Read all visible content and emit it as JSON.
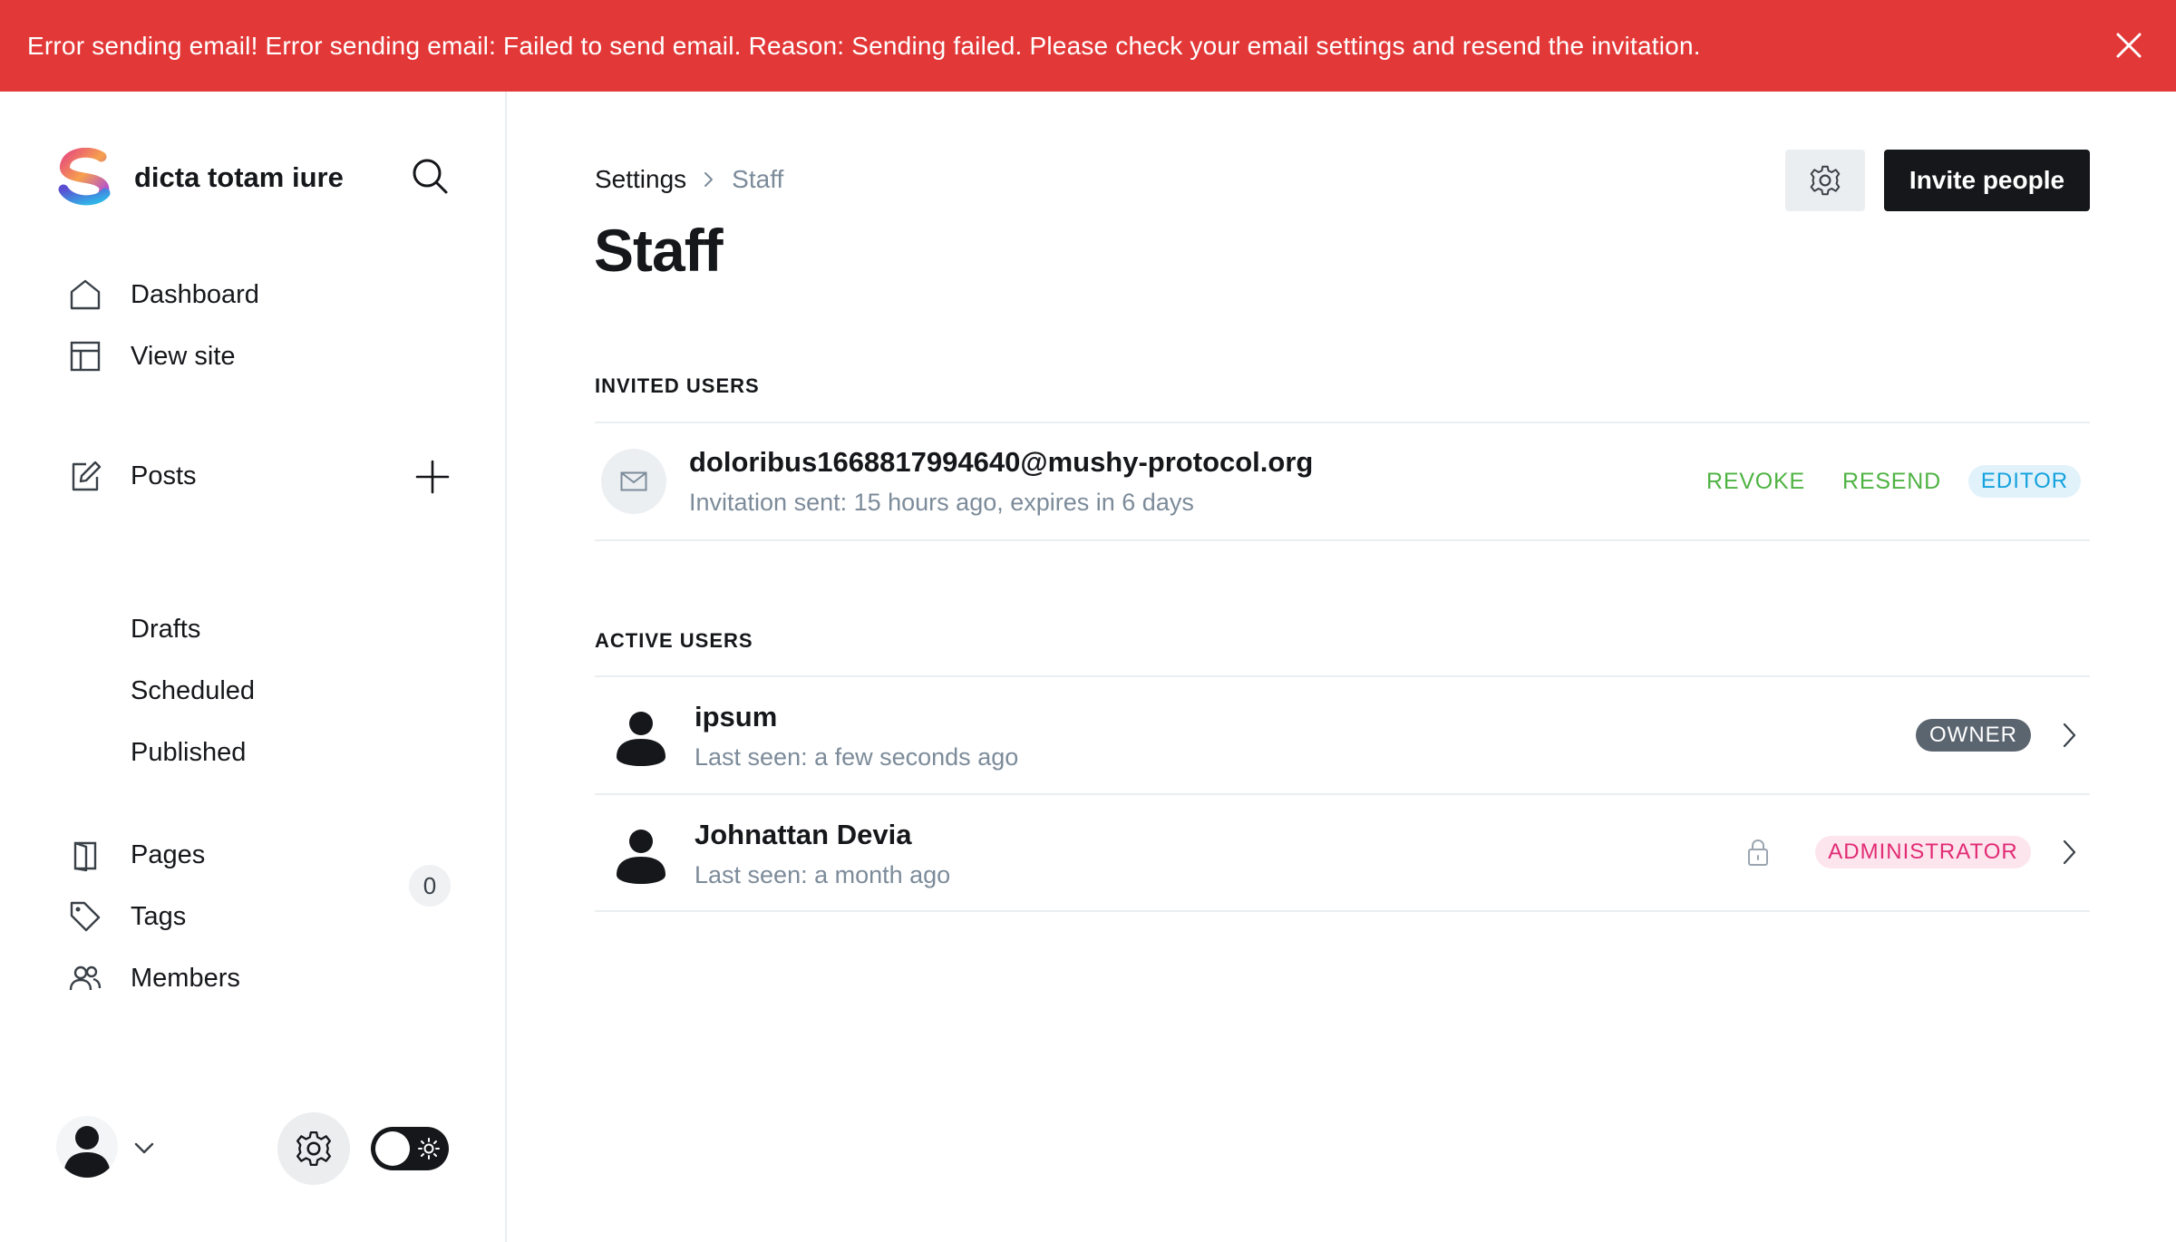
{
  "banner": {
    "message": "Error sending email! Error sending email: Failed to send email. Reason: Sending failed. Please check your email settings and resend the invitation.",
    "close_icon": "close-icon",
    "color": "#e33838"
  },
  "sidebar": {
    "site_name": "dicta totam iure",
    "nav": [
      {
        "label": "Dashboard",
        "icon": "home-icon"
      },
      {
        "label": "View site",
        "icon": "layout-icon"
      }
    ],
    "posts": {
      "label": "Posts",
      "icon": "edit-icon",
      "sub": [
        "Drafts",
        "Scheduled",
        "Published"
      ]
    },
    "nav2": [
      {
        "label": "Pages",
        "icon": "page-icon"
      },
      {
        "label": "Tags",
        "icon": "tag-icon"
      },
      {
        "label": "Members",
        "icon": "members-icon",
        "count": "0"
      }
    ]
  },
  "header": {
    "breadcrumb_root": "Settings",
    "breadcrumb_current": "Staff",
    "title": "Staff",
    "invite_label": "Invite people"
  },
  "invited": {
    "section_label": "INVITED USERS",
    "users": [
      {
        "email": "doloribus1668817994640@mushy-protocol.org",
        "status": "Invitation sent: 15 hours ago, expires in 6 days",
        "revoke_label": "REVOKE",
        "resend_label": "RESEND",
        "role": "EDITOR"
      }
    ]
  },
  "active": {
    "section_label": "ACTIVE USERS",
    "users": [
      {
        "name": "ipsum",
        "last_seen": "Last seen: a few seconds ago",
        "role": "OWNER"
      },
      {
        "name": "Johnattan Devia",
        "last_seen": "Last seen: a month ago",
        "role": "ADMINISTRATOR"
      }
    ]
  },
  "colors": {
    "accent_green": "#4fb343",
    "editor_blue": "#14a2dd",
    "admin_pink": "#e12b73",
    "owner_gray": "#5b6570",
    "dark": "#15171a"
  }
}
